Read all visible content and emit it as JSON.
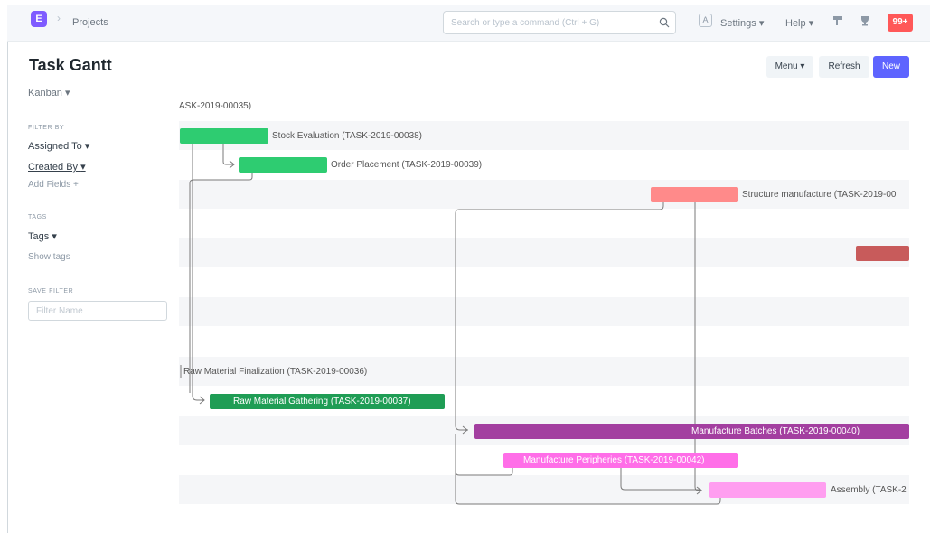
{
  "navbar": {
    "logo_letter": "E",
    "breadcrumb": "Projects",
    "search_placeholder": "Search or type a command (Ctrl + G)",
    "user_initial": "A",
    "settings_label": "Settings",
    "help_label": "Help",
    "notifications_count": "99+"
  },
  "page": {
    "title": "Task Gantt",
    "menu_label": "Menu",
    "refresh_label": "Refresh",
    "new_label": "New"
  },
  "sidebar": {
    "view_label": "Kanban",
    "filter_by_label": "FILTER BY",
    "assigned_to": "Assigned To",
    "created_by": "Created By",
    "add_fields": "Add Fields",
    "tags_label": "TAGS",
    "tags": "Tags",
    "show_tags": "Show tags",
    "save_filter_label": "SAVE FILTER",
    "filter_name_placeholder": "Filter Name"
  },
  "gantt": {
    "tasks": [
      {
        "label": "ASK-2019-00035)",
        "color": ""
      },
      {
        "label": "Stock Evaluation (TASK-2019-00038)",
        "color": "#2ecc71"
      },
      {
        "label": "Order Placement (TASK-2019-00039)",
        "color": "#2ecc71"
      },
      {
        "label": "Structure manufacture (TASK-2019-00",
        "color": "#ff8a8a"
      },
      {
        "label": "",
        "color": "#c85b5b"
      },
      {
        "label": "Raw Material Finalization (TASK-2019-00036)",
        "color": ""
      },
      {
        "label": "Raw Material Gathering (TASK-2019-00037)",
        "color": "#1f9d55"
      },
      {
        "label": "Manufacture Batches (TASK-2019-00040)",
        "color": "#a33fa0"
      },
      {
        "label": "Manufacture Peripheries (TASK-2019-00042)",
        "color": "#ff6ee8"
      },
      {
        "label": "Assembly (TASK-2",
        "color": "#ff9ef0"
      }
    ]
  },
  "colors": {
    "accent": "#5e64ff",
    "brand": "#7f5bff",
    "notification": "#ff5858"
  }
}
